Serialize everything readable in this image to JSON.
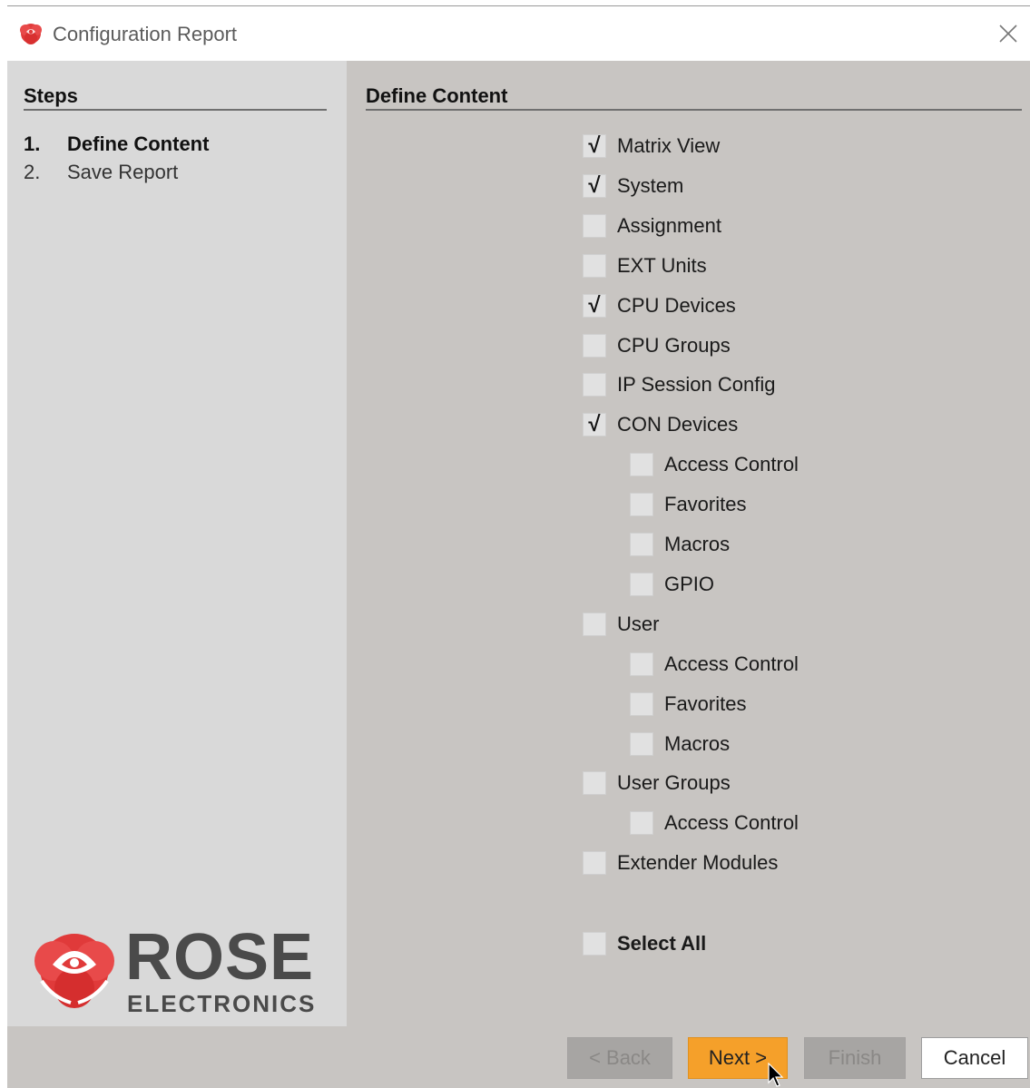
{
  "window": {
    "title": "Configuration Report"
  },
  "steps": {
    "heading": "Steps",
    "items": [
      {
        "num": "1.",
        "label": "Define Content"
      },
      {
        "num": "2.",
        "label": "Save Report"
      }
    ]
  },
  "content": {
    "heading": "Define Content",
    "options": [
      {
        "label": "Matrix View",
        "checked": true,
        "indent": 0
      },
      {
        "label": "System",
        "checked": true,
        "indent": 0
      },
      {
        "label": "Assignment",
        "checked": false,
        "indent": 0
      },
      {
        "label": "EXT Units",
        "checked": false,
        "indent": 0
      },
      {
        "label": "CPU Devices",
        "checked": true,
        "indent": 0
      },
      {
        "label": "CPU Groups",
        "checked": false,
        "indent": 0
      },
      {
        "label": "IP Session Config",
        "checked": false,
        "indent": 0
      },
      {
        "label": "CON Devices",
        "checked": true,
        "indent": 0
      },
      {
        "label": "Access Control",
        "checked": false,
        "indent": 1
      },
      {
        "label": "Favorites",
        "checked": false,
        "indent": 1
      },
      {
        "label": "Macros",
        "checked": false,
        "indent": 1
      },
      {
        "label": "GPIO",
        "checked": false,
        "indent": 1
      },
      {
        "label": "User",
        "checked": false,
        "indent": 0
      },
      {
        "label": "Access Control",
        "checked": false,
        "indent": 1
      },
      {
        "label": "Favorites",
        "checked": false,
        "indent": 1
      },
      {
        "label": "Macros",
        "checked": false,
        "indent": 1
      },
      {
        "label": "User Groups",
        "checked": false,
        "indent": 0
      },
      {
        "label": "Access Control",
        "checked": false,
        "indent": 1
      },
      {
        "label": "Extender Modules",
        "checked": false,
        "indent": 0
      }
    ],
    "select_all": {
      "label": "Select All",
      "checked": false
    }
  },
  "logo": {
    "word": "ROSE",
    "sub": "ELECTRONICS"
  },
  "buttons": {
    "back": "< Back",
    "next": "Next >",
    "finish": "Finish",
    "cancel": "Cancel"
  },
  "colors": {
    "accent": "#f5a02a",
    "panel": "#c8c5c2",
    "sidebar": "#d9d9d9",
    "brand_red": "#e03a3a"
  }
}
